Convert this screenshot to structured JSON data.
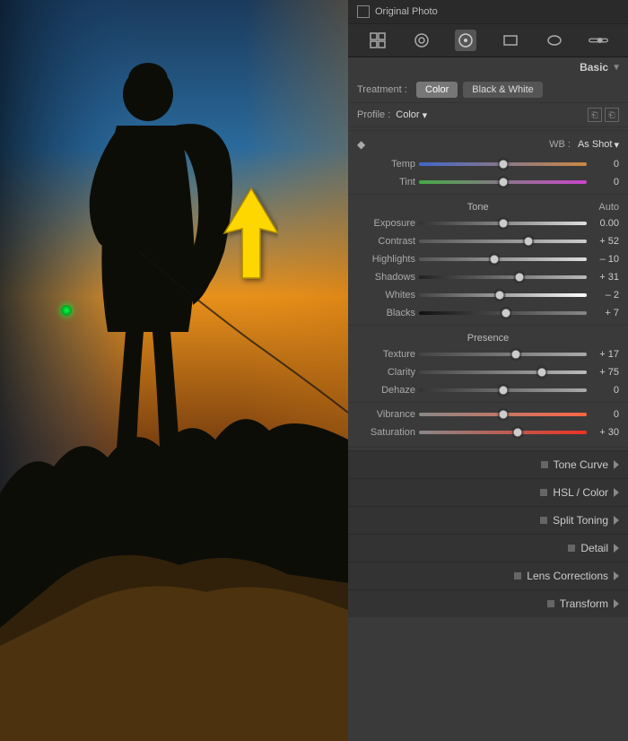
{
  "photo": {
    "green_dot": true
  },
  "topbar": {
    "label": "Original Photo"
  },
  "toolbar": {
    "tools": [
      "grid",
      "crop",
      "spot",
      "redeye",
      "radial",
      "gradient"
    ]
  },
  "panel": {
    "title": "Basic",
    "treatment": {
      "label": "Treatment :",
      "color_btn": "Color",
      "bw_btn": "Black & White"
    },
    "profile": {
      "label": "Profile :",
      "value": "Color",
      "arrow": "▾"
    },
    "wb": {
      "label": "WB :",
      "value": "As Shot",
      "arrow": "▾"
    },
    "tone_title": "Tone",
    "tone_auto": "Auto",
    "sliders": {
      "temp": {
        "label": "Temp",
        "value": "0",
        "thumb": 50,
        "track": "temp-track"
      },
      "tint": {
        "label": "Tint",
        "value": "0",
        "thumb": 50,
        "track": "tint-track"
      },
      "exposure": {
        "label": "Exposure",
        "value": "0.00",
        "thumb": 50,
        "track": "exposure-track"
      },
      "contrast": {
        "label": "Contrast",
        "value": "+ 52",
        "thumb": 65,
        "track": "contrast-track"
      },
      "highlights": {
        "label": "Highlights",
        "value": "– 10",
        "thumb": 45,
        "track": "highlights-track"
      },
      "shadows": {
        "label": "Shadows",
        "value": "+ 31",
        "thumb": 60,
        "track": "shadows-track"
      },
      "whites": {
        "label": "Whites",
        "value": "– 2",
        "thumb": 48,
        "track": "whites-track"
      },
      "blacks": {
        "label": "Blacks",
        "value": "+ 7",
        "thumb": 52,
        "track": "blacks-track"
      },
      "texture": {
        "label": "Texture",
        "value": "+ 17",
        "thumb": 58,
        "track": "texture-track"
      },
      "clarity": {
        "label": "Clarity",
        "value": "+ 75",
        "thumb": 73,
        "track": "clarity-track"
      },
      "dehaze": {
        "label": "Dehaze",
        "value": "0",
        "thumb": 50,
        "track": "dehaze-track"
      },
      "vibrance": {
        "label": "Vibrance",
        "value": "0",
        "thumb": 50,
        "track": "vibrance-track"
      },
      "saturation": {
        "label": "Saturation",
        "value": "+ 30",
        "thumb": 59,
        "track": "saturation-track"
      }
    },
    "presence_title": "Presence",
    "collapsed_sections": [
      {
        "label": "Tone Curve"
      },
      {
        "label": "HSL / Color"
      },
      {
        "label": "Split Toning"
      },
      {
        "label": "Detail"
      },
      {
        "label": "Lens Corrections"
      },
      {
        "label": "Transform"
      }
    ]
  }
}
